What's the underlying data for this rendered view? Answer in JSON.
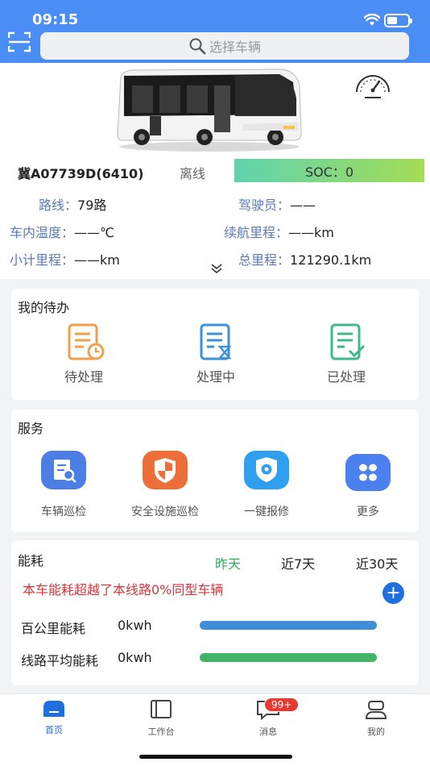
{
  "status": {
    "time": "09:15"
  },
  "search": {
    "placeholder": "选择车辆"
  },
  "vehicle": {
    "plate": "冀A07739D(6410)",
    "state": "离线",
    "soc": "SOC：0",
    "fields": {
      "route_label": "路线：",
      "route": "79路",
      "driver_label": "驾驶员：",
      "driver": "——",
      "temp_label": "车内温度：",
      "temp": "——℃",
      "range_label": "续航里程：",
      "range": "——km",
      "trip_label": "小计里程：",
      "trip": "——km",
      "total_label": "总里程：",
      "total": "121290.1km"
    }
  },
  "todo": {
    "title": "我的待办",
    "items": [
      {
        "label": "待处理",
        "color": "#f0a04b"
      },
      {
        "label": "处理中",
        "color": "#3f8fd8"
      },
      {
        "label": "已处理",
        "color": "#3fb88a"
      }
    ]
  },
  "services": {
    "title": "服务",
    "items": [
      {
        "label": "车辆巡检",
        "icon": "inspection-icon",
        "color": "#4c7fe6"
      },
      {
        "label": "安全设施巡检",
        "icon": "shield-icon",
        "color": "#ee6e3a"
      },
      {
        "label": "一键报修",
        "icon": "repair-icon",
        "color": "#2f9ff0"
      },
      {
        "label": "更多",
        "icon": "more-icon",
        "color": "#4a80f0"
      }
    ]
  },
  "energy": {
    "title": "能耗",
    "tabs": [
      "昨天",
      "近7天",
      "近30天"
    ],
    "active_tab": 0,
    "active_color": "#2fae58",
    "warning": "本车能耗超越了本线路0%同型车辆",
    "metrics": [
      {
        "label": "百公里能耗",
        "value": "0kwh",
        "color": "#3f8fd8",
        "fill": 1.0
      },
      {
        "label": "线路平均能耗",
        "value": "0kwh",
        "color": "#44b36a",
        "fill": 1.0
      }
    ]
  },
  "nav": {
    "items": [
      "首页",
      "工作台",
      "消息",
      "我的"
    ],
    "active": 0,
    "badge": "99+",
    "accent": "#1f6fe0"
  }
}
